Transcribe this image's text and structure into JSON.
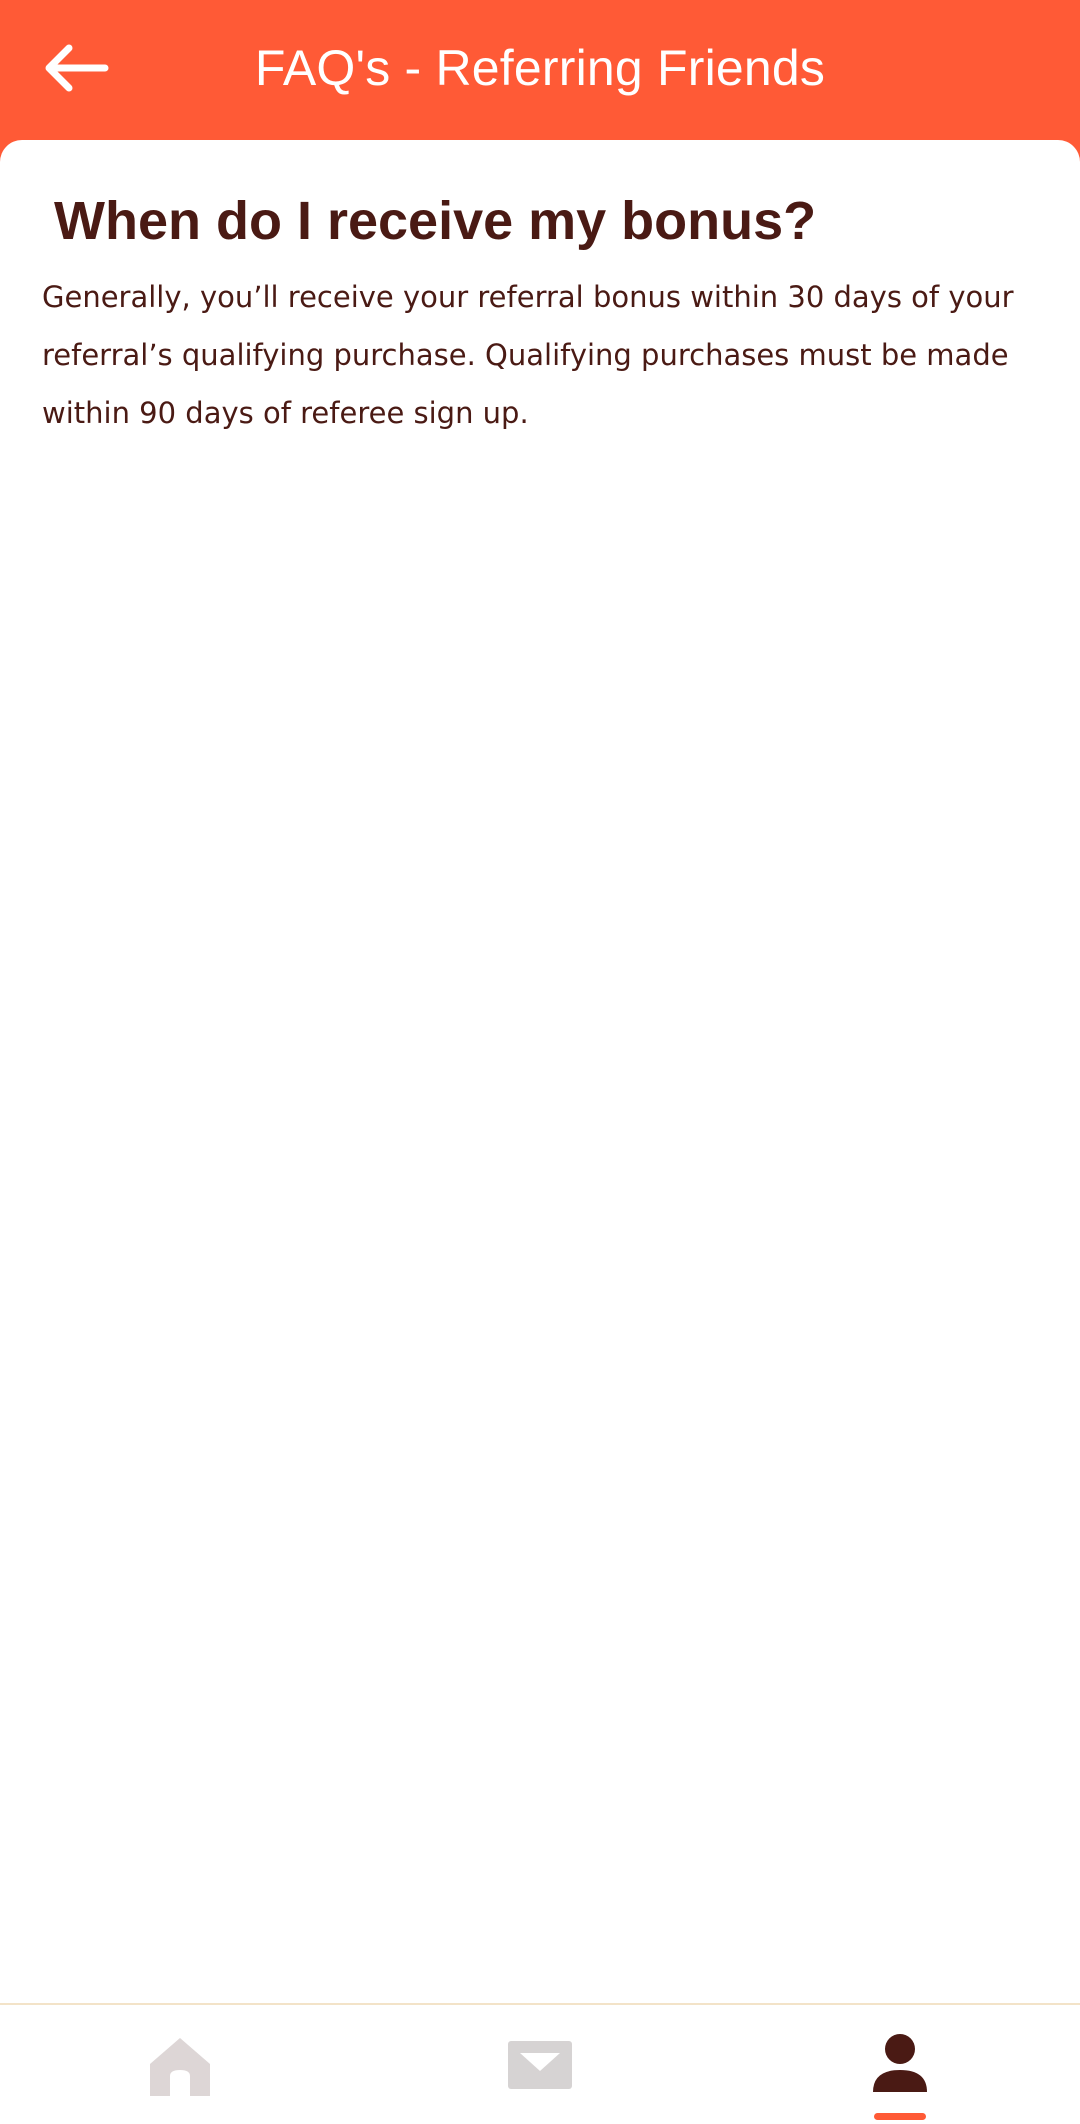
{
  "header": {
    "title": "FAQ's - Referring Friends",
    "back_icon": "arrow-left-icon"
  },
  "faq": {
    "question": "When do I receive my bonus?",
    "answer": "Generally, you’ll receive your referral bonus within 30 days of your referral’s qualifying purchase. Qualifying purchases must be made within 90 days of referee sign up."
  },
  "bottom_nav": {
    "items": [
      {
        "icon": "home-icon",
        "active": false
      },
      {
        "icon": "inbox-icon",
        "active": false
      },
      {
        "icon": "profile-icon",
        "active": true
      }
    ]
  },
  "colors": {
    "brand": "#ff5a36",
    "text_dark": "#4a1a14",
    "nav_inactive": "#ddd6d6",
    "card_bg": "#ffffff"
  }
}
